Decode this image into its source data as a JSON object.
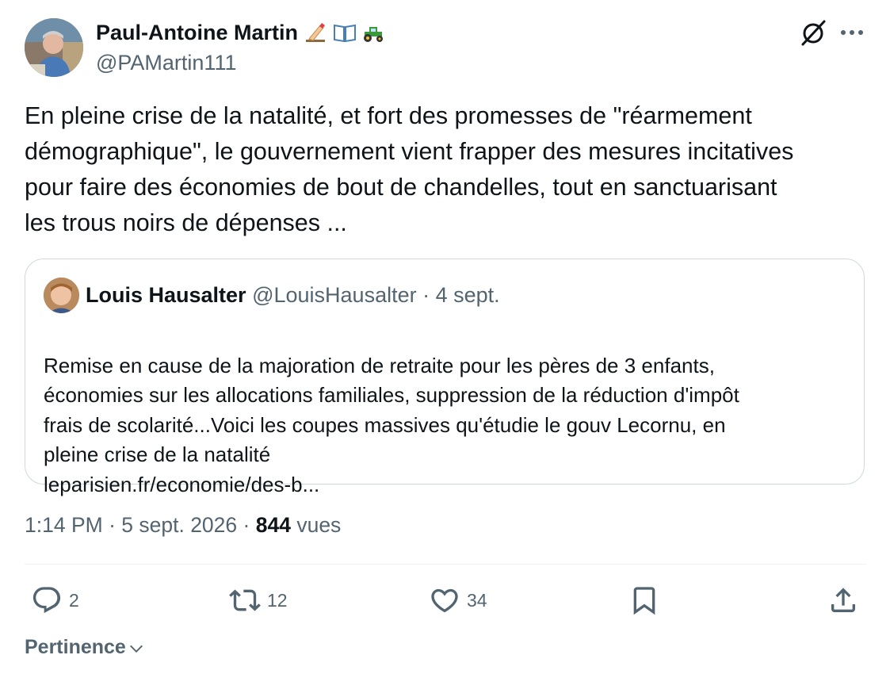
{
  "author": {
    "name": "Paul-Antoine Martin",
    "handle": "@PAMartin111",
    "emojis": [
      "writing-hand-icon",
      "open-book-icon",
      "tractor-icon"
    ]
  },
  "tweet": {
    "text": "En pleine crise de la natalité, et fort des promesses de \"réarmement\ndémographique\", le gouvernement vient frapper des mesures incitatives\npour faire des économies de bout de chandelles, tout en sanctuarisant\nles trous noirs de dépenses ..."
  },
  "quote": {
    "name": "Louis Hausalter",
    "handle": "@LouisHausalter",
    "separator": "·",
    "date": "4 sept.",
    "text": "Remise en cause de la majoration de retraite pour les pères de 3 enfants,\néconomies sur les allocations familiales, suppression de la réduction d'impôt\nfrais de scolarité...Voici les coupes massives qu'étudie le gouv Lecornu, en\npleine crise de la natalité",
    "link": "leparisien.fr/economie/des-b..."
  },
  "meta": {
    "time": "1:14 PM",
    "separator": "·",
    "date": "5 sept. 2026",
    "views_count": "844",
    "views_label": "vues"
  },
  "actions": {
    "replies": "2",
    "reposts": "12",
    "likes": "34"
  },
  "sort": {
    "label": "Pertinence"
  },
  "colors": {
    "text": "#0f1419",
    "secondary": "#536471",
    "border": "#cfd9de"
  }
}
